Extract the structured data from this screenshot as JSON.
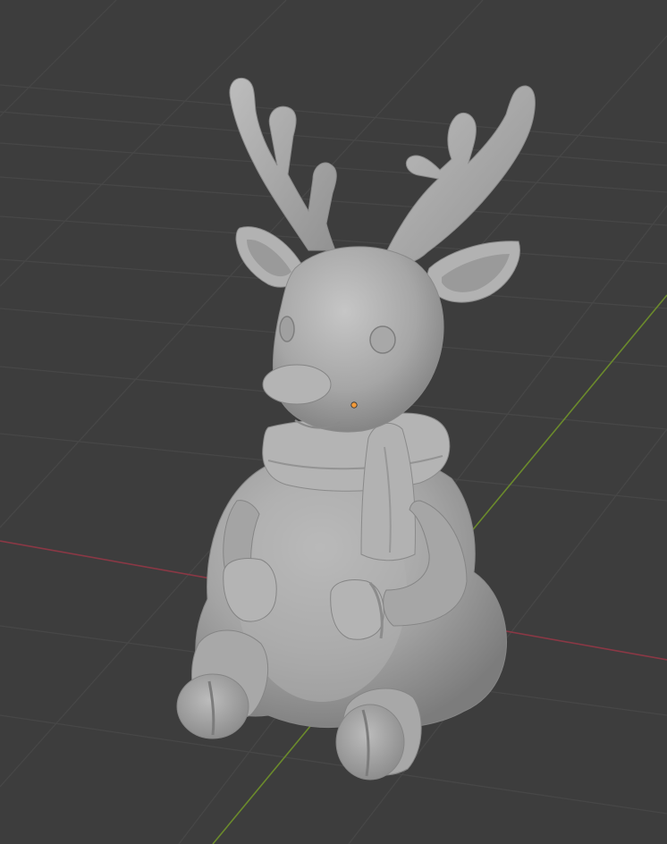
{
  "viewport": {
    "background_color": "#3d3d3d",
    "grid_color": "#4a4a4a",
    "x_axis_color": "#8a3845",
    "y_axis_color": "#6b8a2c",
    "object_origin_color": "#f29a3a",
    "mesh_color": "#a9a9a9"
  },
  "object": {
    "icon": "reindeer-mesh",
    "has_scarf": true,
    "has_antlers": true
  }
}
